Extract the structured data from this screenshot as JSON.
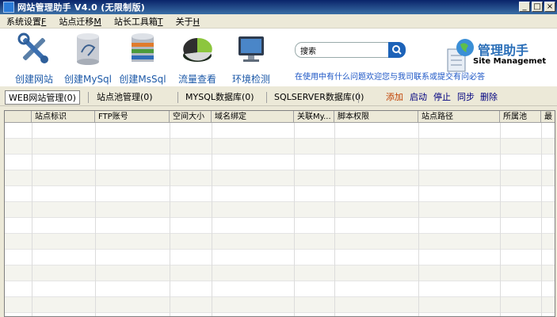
{
  "window": {
    "title": "网站管理助手 V4.0 (无限制版)",
    "min": "_",
    "max": "□",
    "close": "×"
  },
  "menu": [
    {
      "label": "系统设置",
      "key": "F"
    },
    {
      "label": "站点迁移",
      "key": "M"
    },
    {
      "label": "站长工具箱",
      "key": "T"
    },
    {
      "label": "关于",
      "key": "H"
    }
  ],
  "toolbar": [
    {
      "label": "创建网站",
      "icon": "tools-icon"
    },
    {
      "label": "创建MySql",
      "icon": "mysql-db-icon"
    },
    {
      "label": "创建MsSql",
      "icon": "mssql-db-icon"
    },
    {
      "label": "流量查看",
      "icon": "pie-chart-icon"
    },
    {
      "label": "环境检测",
      "icon": "monitor-icon"
    }
  ],
  "search": {
    "value": "搜索"
  },
  "hint": "在使用中有什么问题欢迎您与我司联系或提交有问必答",
  "brand": {
    "cn": "管理助手",
    "en": "Site Managemet"
  },
  "tabs": [
    {
      "label": "WEB网站管理(0)"
    },
    {
      "label": "站点池管理(0)"
    },
    {
      "label": "MYSQL数据库(0)"
    },
    {
      "label": "SQLSERVER数据库(0)"
    }
  ],
  "actions": [
    "添加",
    "启动",
    "停止",
    "同步",
    "删除"
  ],
  "columns": [
    "站点标识",
    "FTP账号",
    "空间大小",
    "域名绑定",
    "关联My...",
    "脚本权限",
    "站点路径",
    "所属池",
    "最"
  ],
  "colors": {
    "title_bar": "#0a246a",
    "label_blue": "#1e5aa8",
    "accent_orange": "#c04000"
  }
}
